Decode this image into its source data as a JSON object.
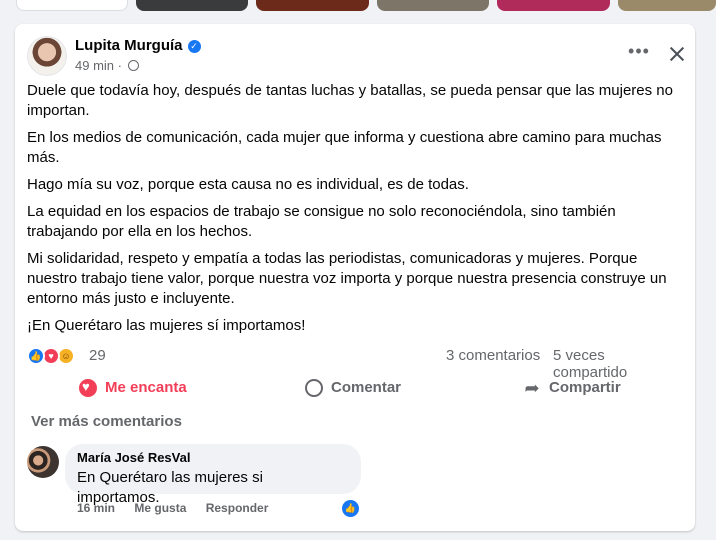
{
  "post": {
    "author": "Lupita Murguía",
    "time": "49 min",
    "separator": "·",
    "paragraphs": [
      "Duele que todavía hoy, después de tantas luchas y batallas, se pueda pensar que las mujeres no importan.",
      "En los medios de comunicación, cada mujer que informa y cuestiona abre camino para muchas más.",
      "Hago mía su voz, porque esta causa no es individual, es de todas.",
      "La equidad en los espacios de trabajo se consigue no solo reconociéndola, sino también trabajando por ella en los hechos.",
      "Mi solidaridad, respeto y empatía a todas las periodistas, comunicadoras y mujeres. Porque nuestro trabajo tiene valor, porque nuestra voz importa y porque nuestra presencia construye un entorno más justo e incluyente.",
      "¡En Querétaro las mujeres sí importamos!"
    ],
    "reaction_count": "29",
    "comments_count": "3 comentarios",
    "shares_count": "5 veces compartido"
  },
  "actions": {
    "love": "Me encanta",
    "comment": "Comentar",
    "share": "Compartir"
  },
  "comments": {
    "see_more": "Ver más comentarios",
    "items": [
      {
        "author": "María José ResVal",
        "text": "En Querétaro las mujeres si importamos.",
        "time": "16 min",
        "like": "Me gusta",
        "reply": "Responder"
      }
    ]
  },
  "icons": [
    "verified-badge-icon",
    "globe-icon",
    "more-options-icon",
    "close-icon",
    "like-reaction-icon",
    "love-reaction-icon",
    "haha-reaction-icon",
    "heart-icon",
    "comment-icon",
    "share-icon"
  ],
  "colors": {
    "accent": "#1877f2",
    "love": "#f33e58",
    "muted": "#65676b"
  }
}
